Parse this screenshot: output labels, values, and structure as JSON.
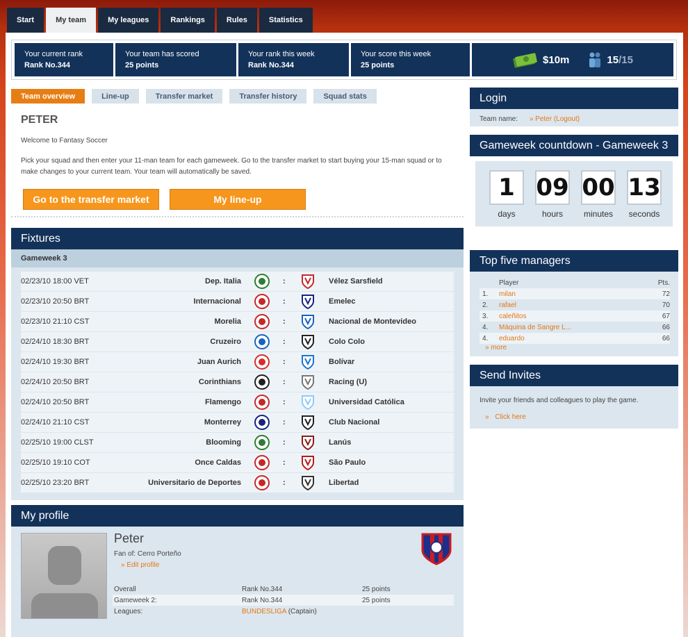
{
  "nav": {
    "tabs": [
      "Start",
      "My team",
      "My leagues",
      "Rankings",
      "Rules",
      "Statistics"
    ],
    "active": 1
  },
  "stats": [
    {
      "label": "Your current rank",
      "value": "Rank No.344"
    },
    {
      "label": "Your team has scored",
      "value": "25 points"
    },
    {
      "label": "Your rank this week",
      "value": "Rank No.344"
    },
    {
      "label": "Your score this week",
      "value": "25 points"
    }
  ],
  "budget": {
    "money": "$10m",
    "squad_current": "15",
    "squad_sep": "/15"
  },
  "subtabs": [
    "Team overview",
    "Line-up",
    "Transfer market",
    "Transfer history",
    "Squad stats"
  ],
  "team": {
    "name": "PETER",
    "welcome": "Welcome to Fantasy Soccer",
    "intro": "Pick your squad and then enter your 11-man team for each gameweek. Go to the transfer market to start buying your 15-man squad or to make changes to your current team. Your team will automatically be saved.",
    "btn_transfer": "Go to the transfer market",
    "btn_lineup": "My line-up"
  },
  "fixtures": {
    "title": "Fixtures",
    "gameweek": "Gameweek 3",
    "rows": [
      {
        "date": "02/23/10 18:00 VET",
        "home": "Dep. Italia",
        "away": "Vélez Sarsfield"
      },
      {
        "date": "02/23/10 20:50 BRT",
        "home": "Internacional",
        "away": "Emelec"
      },
      {
        "date": "02/23/10 21:10 CST",
        "home": "Morelia",
        "away": "Nacional de Montevideo"
      },
      {
        "date": "02/24/10 18:30 BRT",
        "home": "Cruzeiro",
        "away": "Colo Colo"
      },
      {
        "date": "02/24/10 19:30 BRT",
        "home": "Juan Aurich",
        "away": "Bolívar"
      },
      {
        "date": "02/24/10 20:50 BRT",
        "home": "Corinthians",
        "away": "Racing (U)"
      },
      {
        "date": "02/24/10 20:50 BRT",
        "home": "Flamengo",
        "away": "Universidad Católica"
      },
      {
        "date": "02/24/10 21:10 CST",
        "home": "Monterrey",
        "away": "Club Nacional"
      },
      {
        "date": "02/25/10 19:00 CLST",
        "home": "Blooming",
        "away": "Lanús"
      },
      {
        "date": "02/25/10 19:10 COT",
        "home": "Once Caldas",
        "away": "São Paulo"
      },
      {
        "date": "02/25/10 23:20 BRT",
        "home": "Universitario de Deportes",
        "away": "Libertad"
      }
    ],
    "colon": ":"
  },
  "profile": {
    "title": "My profile",
    "name": "Peter",
    "fan_of": "Fan of: Cerro Porteño",
    "edit": "» Edit profile",
    "rows": [
      {
        "label": "Overall",
        "rank": "Rank No.344",
        "points": "25 points"
      },
      {
        "label": "Gameweek 2:",
        "rank": "Rank No.344",
        "points": "25 points"
      }
    ],
    "leagues_label": "Leagues:",
    "league_name": "BUNDESLIGA",
    "league_role": "(Captain)"
  },
  "login": {
    "title": "Login",
    "label": "Team name:",
    "value": "» Peter (Logout)"
  },
  "countdown": {
    "title": "Gameweek countdown - Gameweek 3",
    "units": [
      {
        "value": "1",
        "label": "days"
      },
      {
        "value": "09",
        "label": "hours"
      },
      {
        "value": "00",
        "label": "minutes"
      },
      {
        "value": "13",
        "label": "seconds"
      }
    ]
  },
  "top_managers": {
    "title": "Top five managers",
    "col_player": "Player",
    "col_points": "Pts.",
    "rows": [
      {
        "rank": "1.",
        "name": "milan",
        "pts": "72"
      },
      {
        "rank": "2.",
        "name": "rafael",
        "pts": "70"
      },
      {
        "rank": "3.",
        "name": "caleñitos",
        "pts": "67"
      },
      {
        "rank": "4.",
        "name": "Máquina de Sangre L...",
        "pts": "66"
      },
      {
        "rank": "4.",
        "name": "eduardo",
        "pts": "66"
      }
    ],
    "more": "» more"
  },
  "invites": {
    "title": "Send Invites",
    "text": "Invite your friends and colleagues to play the game.",
    "link": "Click here"
  }
}
